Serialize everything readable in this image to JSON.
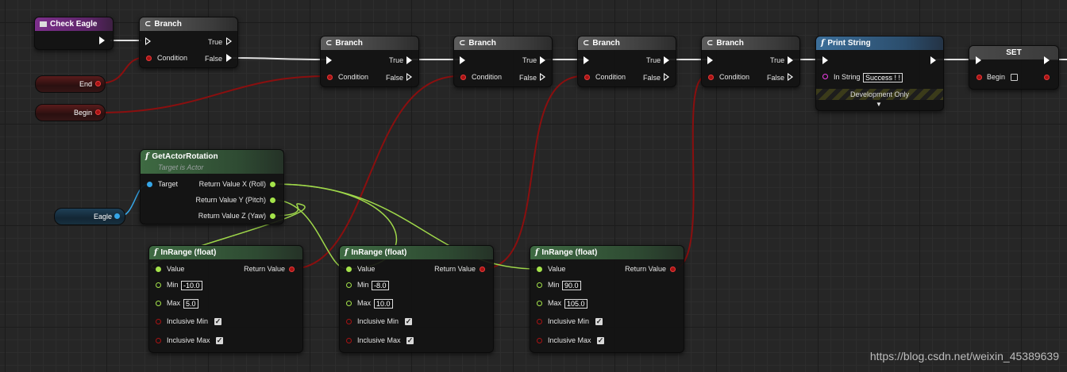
{
  "nodes": {
    "check_eagle": {
      "title": "Check Eagle"
    },
    "branch1": {
      "title": "Branch",
      "true": "True",
      "false": "False",
      "condition": "Condition"
    },
    "branch2": {
      "title": "Branch",
      "true": "True",
      "false": "False",
      "condition": "Condition"
    },
    "branch3": {
      "title": "Branch",
      "true": "True",
      "false": "False",
      "condition": "Condition"
    },
    "branch4": {
      "title": "Branch",
      "true": "True",
      "false": "False",
      "condition": "Condition"
    },
    "branch5": {
      "title": "Branch",
      "true": "True",
      "false": "False",
      "condition": "Condition"
    },
    "print_string": {
      "title": "Print String",
      "in_string_label": "In String",
      "in_string_value": "Success ! !",
      "dev_only": "Development Only",
      "expand": "▼"
    },
    "set": {
      "title": "SET",
      "begin": "Begin"
    },
    "var_end": {
      "label": "End"
    },
    "var_begin": {
      "label": "Begin"
    },
    "var_eagle": {
      "label": "Eagle"
    },
    "get_actor_rotation": {
      "title": "GetActorRotation",
      "subtitle": "Target is Actor",
      "target": "Target",
      "out_x": "Return Value X (Roll)",
      "out_y": "Return Value Y (Pitch)",
      "out_z": "Return Value Z (Yaw)"
    },
    "inrange1": {
      "title": "InRange (float)",
      "value": "Value",
      "return": "Return Value",
      "min": "Min",
      "min_val": "-10.0",
      "max": "Max",
      "max_val": "5.0",
      "inc_min": "Inclusive Min",
      "inc_max": "Inclusive Max"
    },
    "inrange2": {
      "title": "InRange (float)",
      "value": "Value",
      "return": "Return Value",
      "min": "Min",
      "min_val": "-8.0",
      "max": "Max",
      "max_val": "10.0",
      "inc_min": "Inclusive Min",
      "inc_max": "Inclusive Max"
    },
    "inrange3": {
      "title": "InRange (float)",
      "value": "Value",
      "return": "Return Value",
      "min": "Min",
      "min_val": "90.0",
      "max": "Max",
      "max_val": "105.0",
      "inc_min": "Inclusive Min",
      "inc_max": "Inclusive Max"
    }
  },
  "icons": {
    "branch": "branch-icon",
    "function": "function-icon",
    "event": "event-icon",
    "check": "checkmark-icon"
  },
  "colors": {
    "exec": "#ffffff",
    "bool": "#a81313",
    "float": "#a4e34a",
    "object": "#35a6e8",
    "string": "#f13ee8"
  },
  "watermark": "https://blog.csdn.net/weixin_45389639"
}
